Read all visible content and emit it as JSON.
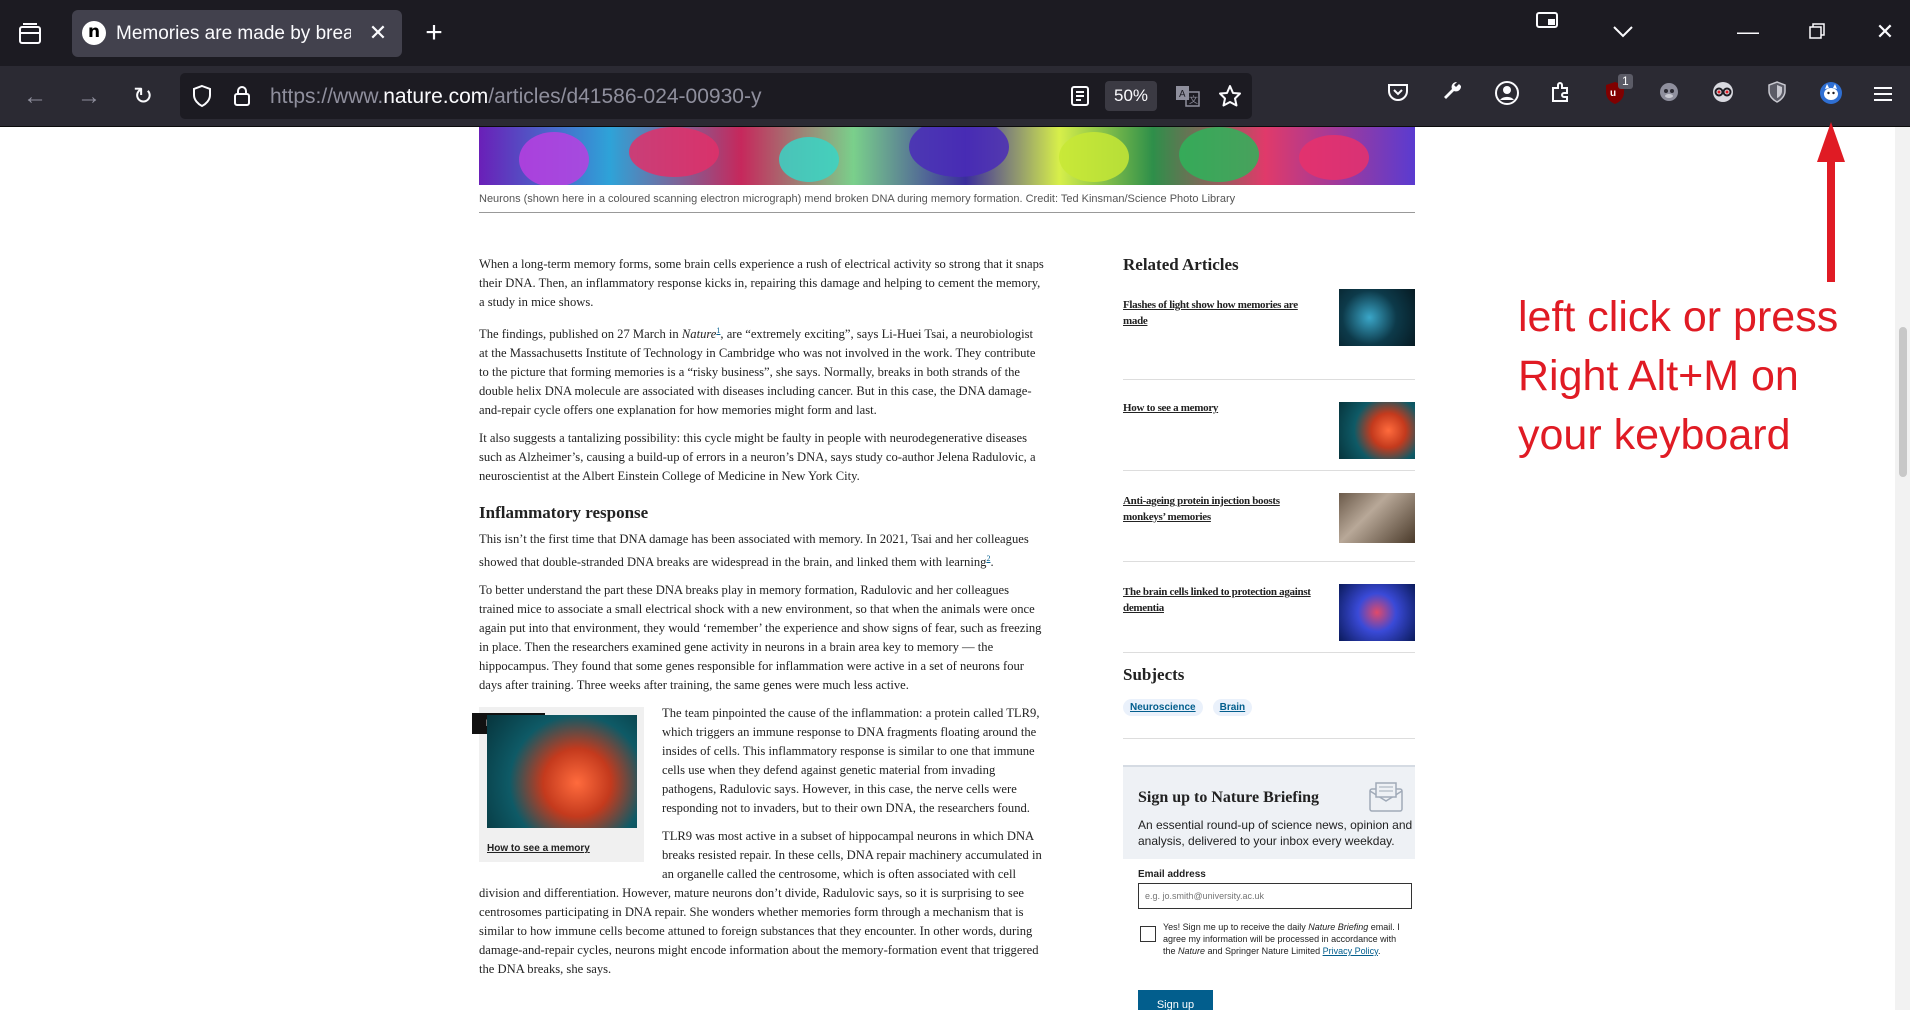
{
  "browser": {
    "tab_title": "Memories are made by breaking DNA — and fixing it",
    "favicon_letter": "n",
    "url_prefix": "https://www.",
    "url_domain": "nature.com",
    "url_path": "/articles/d41586-024-00930-y",
    "zoom": "50%",
    "ublock_badge": "1"
  },
  "figure": {
    "caption": "Neurons (shown here in a coloured scanning electron micrograph) mend broken DNA during memory formation. Credit: Ted Kinsman/Science Photo Library"
  },
  "article": {
    "p1": "When a long-term memory forms, some brain cells experience a rush of electrical activity so strong that it snaps their DNA. Then, an inflammatory response kicks in, repairing this damage and helping to cement the memory, a study in mice shows.",
    "p2a": "The findings, published on 27 March in ",
    "p2_journal": "Nature",
    "p2_ref": "1",
    "p2b": ", are “extremely exciting”, says Li-Huei Tsai, a neurobiologist at the Massachusetts Institute of Technology in Cambridge who was not involved in the work. They contribute to the picture that forming memories is a “risky business”, she says. Normally, breaks in both strands of the double helix DNA molecule are associated with diseases including cancer. But in this case, the DNA damage-and-repair cycle offers one explanation for how memories might form and last.",
    "p3": "It also suggests a tantalizing possibility: this cycle might be faulty in people with neurodegenerative diseases such as Alzheimer’s, causing a build-up of errors in a neuron’s DNA, says study co-author Jelena Radulovic, a neuroscientist at the Albert Einstein College of Medicine in New York City.",
    "h2": "Inflammatory response",
    "p4a": "This isn’t the first time that DNA damage has been associated with memory. In 2021, Tsai and her colleagues showed that double-stranded DNA breaks are widespread in the brain, and linked them with learning",
    "p4_ref": "2",
    "p4b": ".",
    "p5": "To better understand the part these DNA breaks play in memory formation, Radulovic and her colleagues trained mice to associate a small electrical shock with a new environment, so that when the animals were once again put into that environment, they would ‘remember’ the experience and show signs of fear, such as freezing in place. Then the researchers examined gene activity in neurons in a brain area key to memory — the hippocampus. They found that some genes responsible for inflammation were active in a set of neurons four days after training. Three weeks after training, the same genes were much less active.",
    "p6": "The team pinpointed the cause of the inflammation: a protein called TLR9, which triggers an immune response to DNA fragments floating around the insides of cells. This inflammatory response is similar to one that immune cells use when they defend against genetic material from invading pathogens, Radulovic says. However, in this case, the nerve cells were responding not to invaders, but to their own DNA, the researchers found.",
    "p7": "TLR9 was most active in a subset of hippocampal neurons in which DNA breaks resisted repair. In these cells, DNA repair machinery accumulated in an organelle called the centrosome, which is often associated with cell division and differentiation. However, mature neurons don’t divide, Radulovic says, so it is surprising to see centrosomes participating in DNA repair. She wonders whether memories form through a mechanism that is similar to how immune cells become attuned to foreign substances that they encounter. In other words, during damage-and-repair cycles, neurons might encode information about the memory-formation event that triggered the DNA breaks, she says.",
    "related_tag": "RELATED",
    "related_link": "How to see a memory"
  },
  "sidebar": {
    "related_heading": "Related Articles",
    "related": [
      {
        "title": "Flashes of light show how memories are made"
      },
      {
        "title": "How to see a memory"
      },
      {
        "title": "Anti-ageing protein injection boosts monkeys’ memories"
      },
      {
        "title": "The brain cells linked to protection against dementia"
      }
    ],
    "subjects_heading": "Subjects",
    "subjects": [
      "Neuroscience",
      "Brain"
    ]
  },
  "briefing": {
    "title": "Sign up to Nature Briefing",
    "description": "An essential round-up of science news, opinion and analysis, delivered to your inbox every weekday.",
    "email_label": "Email address",
    "email_placeholder": "e.g. jo.smith@university.ac.uk",
    "consent_a": "Yes! Sign me up to receive the daily ",
    "consent_em": "Nature Briefing",
    "consent_b": " email. I agree my information will be processed in accordance with the ",
    "consent_em2": "Nature",
    "consent_c": " and Springer Nature Limited ",
    "consent_link": "Privacy Policy",
    "consent_d": ".",
    "signup": "Sign up"
  },
  "annotation": {
    "text": "left click or press Right Alt+M on your keyboard",
    "color": "#e01b24"
  }
}
